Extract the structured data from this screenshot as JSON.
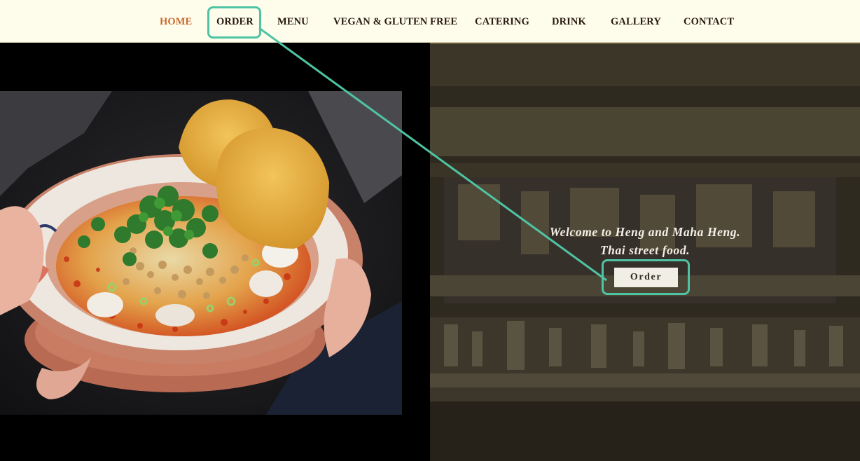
{
  "nav": {
    "items": [
      {
        "label": "HOME",
        "active": true
      },
      {
        "label": "ORDER",
        "active": false
      },
      {
        "label": "MENU",
        "active": false
      },
      {
        "label": "VEGAN & GLUTEN FREE",
        "active": false
      },
      {
        "label": "CATERING",
        "active": false
      },
      {
        "label": "DRINK",
        "active": false
      },
      {
        "label": "GALLERY",
        "active": false
      },
      {
        "label": "CONTACT",
        "active": false
      }
    ]
  },
  "hero": {
    "welcome_line1": "Welcome to Heng and Maha Heng.",
    "welcome_line2": "Thai street food.",
    "order_label": "Order"
  },
  "colors": {
    "nav_bg": "#fefdec",
    "nav_text": "#2a1a12",
    "nav_active": "#c9682d",
    "highlight": "#4fc4a4",
    "hero_bg": "#2b261c",
    "button_bg": "#f1eee6"
  }
}
